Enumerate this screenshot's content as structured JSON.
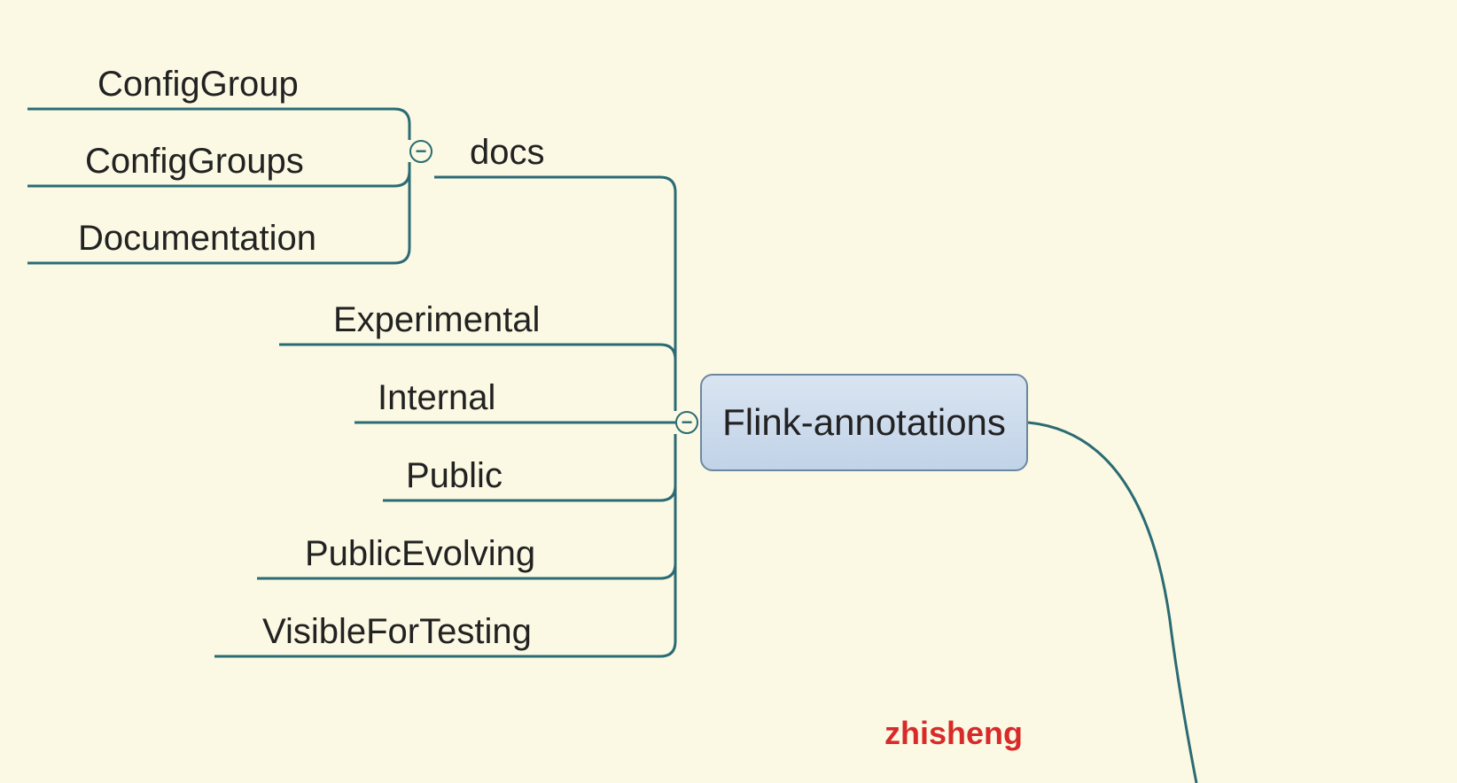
{
  "root": {
    "label": "Flink-annotations"
  },
  "branches": {
    "docs": {
      "label": "docs",
      "children": [
        "ConfigGroup",
        "ConfigGroups",
        "Documentation"
      ]
    },
    "direct": [
      "Experimental",
      "Internal",
      "Public",
      "PublicEvolving",
      "VisibleForTesting"
    ]
  },
  "watermark": "zhisheng",
  "collapse_glyph": "−"
}
